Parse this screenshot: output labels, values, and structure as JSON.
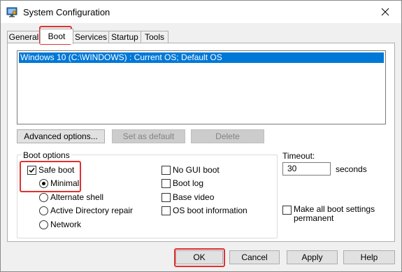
{
  "window": {
    "title": "System Configuration",
    "app_icon": "msconfig-icon",
    "close_icon": "close-icon"
  },
  "tabs": [
    {
      "label": "General"
    },
    {
      "label": "Boot"
    },
    {
      "label": "Services"
    },
    {
      "label": "Startup"
    },
    {
      "label": "Tools"
    }
  ],
  "boot": {
    "os_entries": [
      "Windows 10 (C:\\WINDOWS) : Current OS; Default OS"
    ],
    "advanced_options_label": "Advanced options...",
    "set_default_label": "Set as default",
    "delete_label": "Delete",
    "boot_options_label": "Boot options",
    "safe_boot": {
      "label": "Safe boot",
      "checked": true
    },
    "safe_boot_modes": [
      {
        "label": "Minimal",
        "selected": true
      },
      {
        "label": "Alternate shell",
        "selected": false
      },
      {
        "label": "Active Directory repair",
        "selected": false
      },
      {
        "label": "Network",
        "selected": false
      }
    ],
    "option_checkboxes": [
      {
        "label": "No GUI boot",
        "checked": false
      },
      {
        "label": "Boot log",
        "checked": false
      },
      {
        "label": "Base video",
        "checked": false
      },
      {
        "label": "OS boot information",
        "checked": false
      }
    ],
    "timeout_label": "Timeout:",
    "timeout_value": "30",
    "seconds_label": "seconds",
    "make_permanent": {
      "label_line1": "Make all boot settings",
      "label_line2": "permanent",
      "checked": false
    }
  },
  "footer": {
    "ok_label": "OK",
    "cancel_label": "Cancel",
    "apply_label": "Apply",
    "help_label": "Help"
  },
  "colors": {
    "selection": "#0078d7",
    "highlight": "#e03131"
  }
}
